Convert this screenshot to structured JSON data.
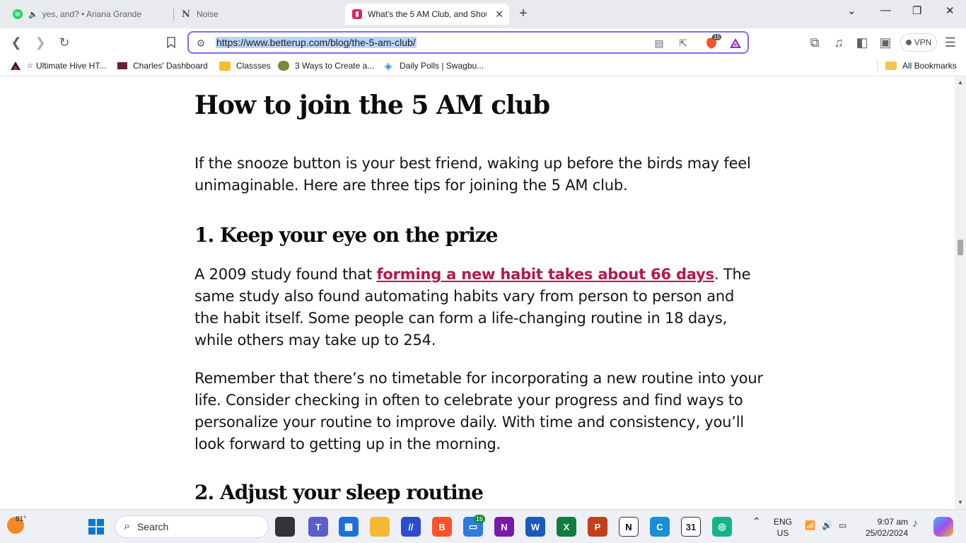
{
  "tabs": [
    {
      "title": "yes, and? • Ariana Grande",
      "icon": "spotify-icon"
    },
    {
      "title": "Noise",
      "icon": "notion-n-icon"
    },
    {
      "title": "What's the 5 AM Club, and Shou",
      "icon": "betterup-icon"
    }
  ],
  "address_bar": {
    "url": "https://www.betterup.com/blog/the-5-am-club/",
    "shield_count": "15"
  },
  "vpn_label": "VPN",
  "bookmarks": [
    {
      "label": "Ultimate Hive HT..."
    },
    {
      "label": "Charles' Dashboard"
    },
    {
      "label": "Classses"
    },
    {
      "label": "3 Ways to Create a..."
    },
    {
      "label": "Daily Polls | Swagbu..."
    }
  ],
  "all_bookmarks": "All Bookmarks",
  "article": {
    "heading_main": "How to join the 5 AM club",
    "intro": "If the snooze button is your best friend, waking up before the birds may feel unimaginable. Here are three tips for joining the 5 AM club.",
    "section1_heading": "1. Keep your eye on the prize",
    "section1_pre": "A 2009 study found that ",
    "section1_link": "forming a new habit takes about 66 days",
    "section1_post": ". The same study also found automating habits vary from person to person and the habit itself. Some people can form a life-changing routine in 18 days, while others may take up to 254.",
    "section1_para2": "Remember that there’s no timetable for incorporating a new routine into your life. Consider checking in often to celebrate your progress and find ways to personalize your routine to improve daily. With time and consistency, you’ll look forward to getting up in the morning.",
    "section2_heading": "2. Adjust your sleep routine"
  },
  "taskbar": {
    "weather": "81°",
    "search_label": "Search",
    "teams_badge": "16",
    "lang_top": "ENG",
    "lang_bottom": "US",
    "time": "9:07 am",
    "date": "25/02/2024"
  }
}
